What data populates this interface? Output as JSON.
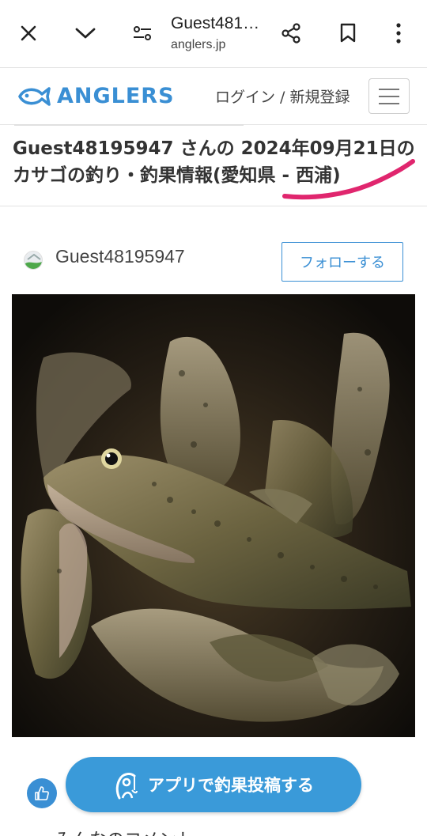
{
  "browser": {
    "title": "Guest481…",
    "url": "anglers.jp"
  },
  "header": {
    "logo_text": "ANGLERS",
    "login_link": "ログイン / 新規登録"
  },
  "page": {
    "title": "Guest48195947 さんの 2024年09月21日のカサゴの釣り・釣果情報(愛知県 - 西浦)",
    "highlight_color": "#e0266e"
  },
  "user": {
    "name": "Guest48195947",
    "follow_label": "フォローする"
  },
  "actions": {
    "app_post_label": "アプリで釣果投稿する"
  },
  "footer_peek": "・ みんなのコメント",
  "colors": {
    "brand": "#3a8fd4",
    "button": "#3a9ad9"
  }
}
